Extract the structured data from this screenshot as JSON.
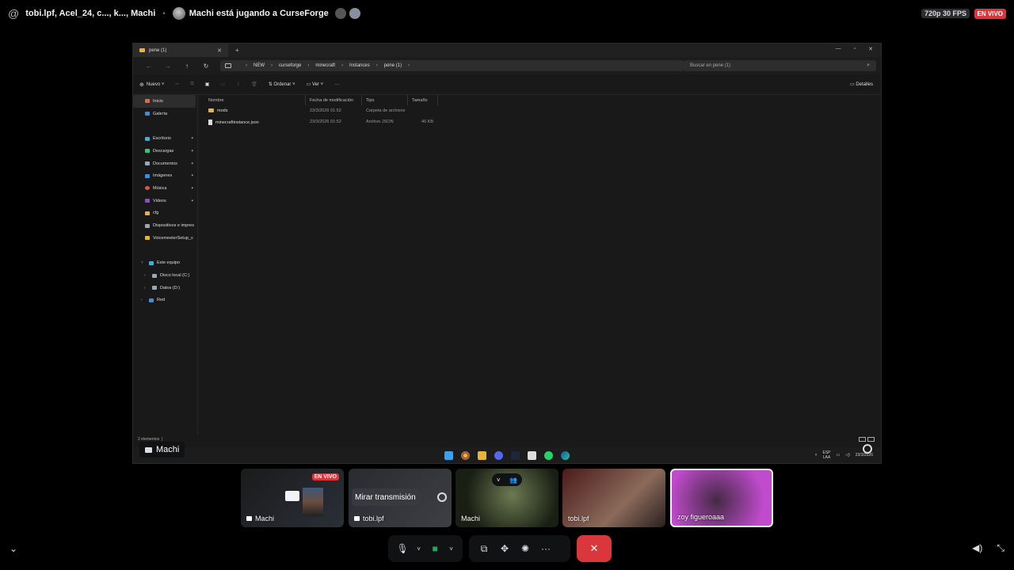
{
  "header": {
    "channel_names": "tobi.lpf, Acel_24, c..., k..., Machi",
    "activity": "Machi está jugando a CurseForge",
    "quality": "720p 30 FPS",
    "live_badge": "EN VIVO"
  },
  "explorer": {
    "tab_title": "pene (1)",
    "breadcrumbs": [
      "NEW",
      "curseforge",
      "minecraft",
      "Instances",
      "pene (1)"
    ],
    "search_placeholder": "Buscar en pene (1)",
    "toolbar": {
      "new_label": "Nuevo",
      "sort_label": "Ordenar",
      "view_label": "Ver",
      "more_label": "···",
      "details_label": "Detalles"
    },
    "sidebar": [
      {
        "label": "Inicio",
        "color": "#e06c3a",
        "selected": true
      },
      {
        "label": "Galería",
        "color": "#3a8ee0"
      },
      {
        "label": "Escritorio",
        "color": "#3ab0e0",
        "pinned": true
      },
      {
        "label": "Descargas",
        "color": "#3ac17a",
        "pinned": true
      },
      {
        "label": "Documentos",
        "color": "#9aa7b8",
        "pinned": true
      },
      {
        "label": "Imágenes",
        "color": "#3a8ee0",
        "pinned": true
      },
      {
        "label": "Música",
        "color": "#e0563a",
        "pinned": true
      },
      {
        "label": "Videos",
        "color": "#8a4bd6",
        "pinned": true
      },
      {
        "label": "cfg",
        "color": "#e8b33c"
      },
      {
        "label": "Dispositivos e impres",
        "color": "#9aa7b8"
      },
      {
        "label": "VoicemeeterSetup_v",
        "color": "#e8b33c"
      }
    ],
    "tree": [
      {
        "label": "Este equipo",
        "color": "#3ab0e0",
        "expanded": true
      },
      {
        "label": "Disco local (C:)",
        "color": "#9aa7b8",
        "sub": true
      },
      {
        "label": "Datos (D:)",
        "color": "#9aa7b8",
        "sub": true
      },
      {
        "label": "Red",
        "color": "#3a8ee0"
      }
    ],
    "columns": [
      "Nombre",
      "Fecha de modificación",
      "Tipo",
      "Tamaño"
    ],
    "files": [
      {
        "name": "mods",
        "date": "23/3/2026 01:52",
        "type": "Carpeta de archivos",
        "size": "",
        "kind": "folder"
      },
      {
        "name": "minecraftinstance.json",
        "date": "23/3/2026 01:52",
        "type": "Archivo JSON",
        "size": "46 KB",
        "kind": "file"
      }
    ],
    "status": "2 elementos",
    "tray": {
      "lang_top": "ESP",
      "lang_bottom": "LAA",
      "date": "23/3/2026"
    }
  },
  "streamer_tag": "Machi",
  "participants": [
    {
      "name": "Machi",
      "live": "EN VIVO"
    },
    {
      "name": "tobi.lpf",
      "watch": "Mirar transmisión"
    },
    {
      "name": "Machi"
    },
    {
      "name": "tobi.lpf"
    },
    {
      "name": "zoy figueroaaa"
    }
  ]
}
